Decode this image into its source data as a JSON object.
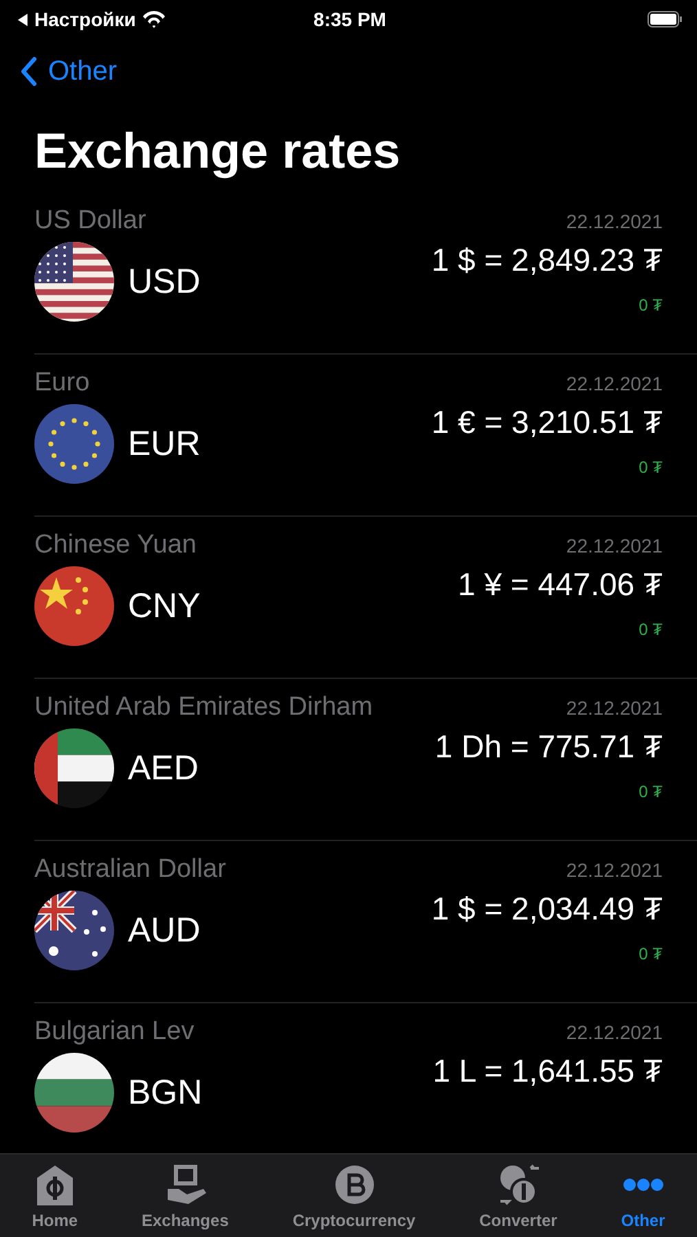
{
  "status_bar": {
    "back_app": "Настройки",
    "time": "8:35 PM"
  },
  "nav": {
    "back": "Other",
    "title": "Exchange rates"
  },
  "rates": [
    {
      "name": "US Dollar",
      "date": "22.12.2021",
      "kind": "us",
      "code": "USD",
      "rate": "1 $ = 2,849.23 ₮",
      "change": "0 ₮"
    },
    {
      "name": "Euro",
      "date": "22.12.2021",
      "kind": "eu",
      "code": "EUR",
      "rate": "1 € = 3,210.51 ₮",
      "change": "0 ₮"
    },
    {
      "name": "Chinese Yuan",
      "date": "22.12.2021",
      "kind": "cn",
      "code": "CNY",
      "rate": "1 ¥ = 447.06 ₮",
      "change": "0 ₮"
    },
    {
      "name": "United Arab Emirates Dirham",
      "date": "22.12.2021",
      "kind": "ae",
      "code": "AED",
      "rate": "1 Dh = 775.71 ₮",
      "change": "0 ₮"
    },
    {
      "name": "Australian Dollar",
      "date": "22.12.2021",
      "kind": "au",
      "code": "AUD",
      "rate": "1 $ = 2,034.49 ₮",
      "change": "0 ₮"
    },
    {
      "name": "Bulgarian Lev",
      "date": "22.12.2021",
      "kind": "bg",
      "code": "BGN",
      "rate": "1 L = 1,641.55 ₮"
    }
  ],
  "tabs": [
    {
      "label": "Home",
      "kind": "home",
      "selected": false
    },
    {
      "label": "Exchanges",
      "kind": "exchange",
      "selected": false
    },
    {
      "label": "Cryptocurrency",
      "kind": "crypto",
      "selected": false
    },
    {
      "label": "Converter",
      "kind": "converter",
      "selected": false
    },
    {
      "label": "Other",
      "kind": "more",
      "selected": true
    }
  ]
}
